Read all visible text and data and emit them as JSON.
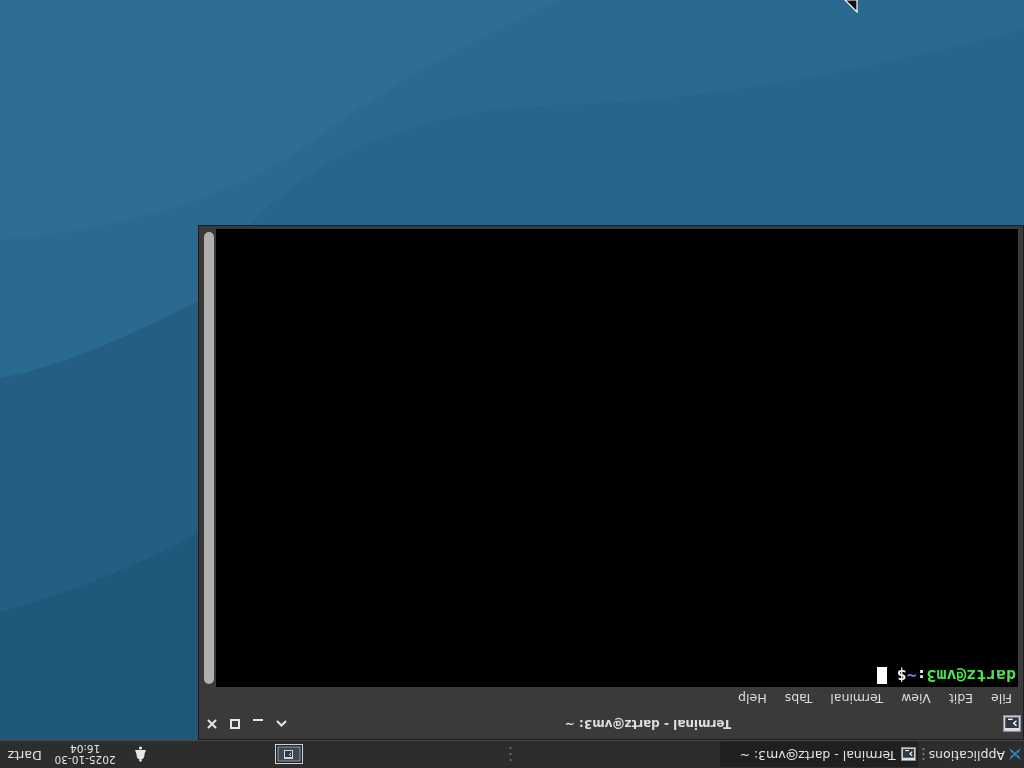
{
  "panel": {
    "applications": "Applications",
    "tasks": [
      {
        "title": "Terminal - dartz@vm3: ~",
        "selected": true
      }
    ],
    "clock": {
      "date": "2025-10-30",
      "time": "16:04"
    },
    "user": "Dartz"
  },
  "window": {
    "title": "Terminal - dartz@vm3: ~",
    "menu": [
      "File",
      "Edit",
      "View",
      "Terminal",
      "Tabs",
      "Help"
    ],
    "prompt": {
      "user_host": "dartz@vm3",
      "separator": ":",
      "path": "~",
      "symbol": "$"
    }
  }
}
